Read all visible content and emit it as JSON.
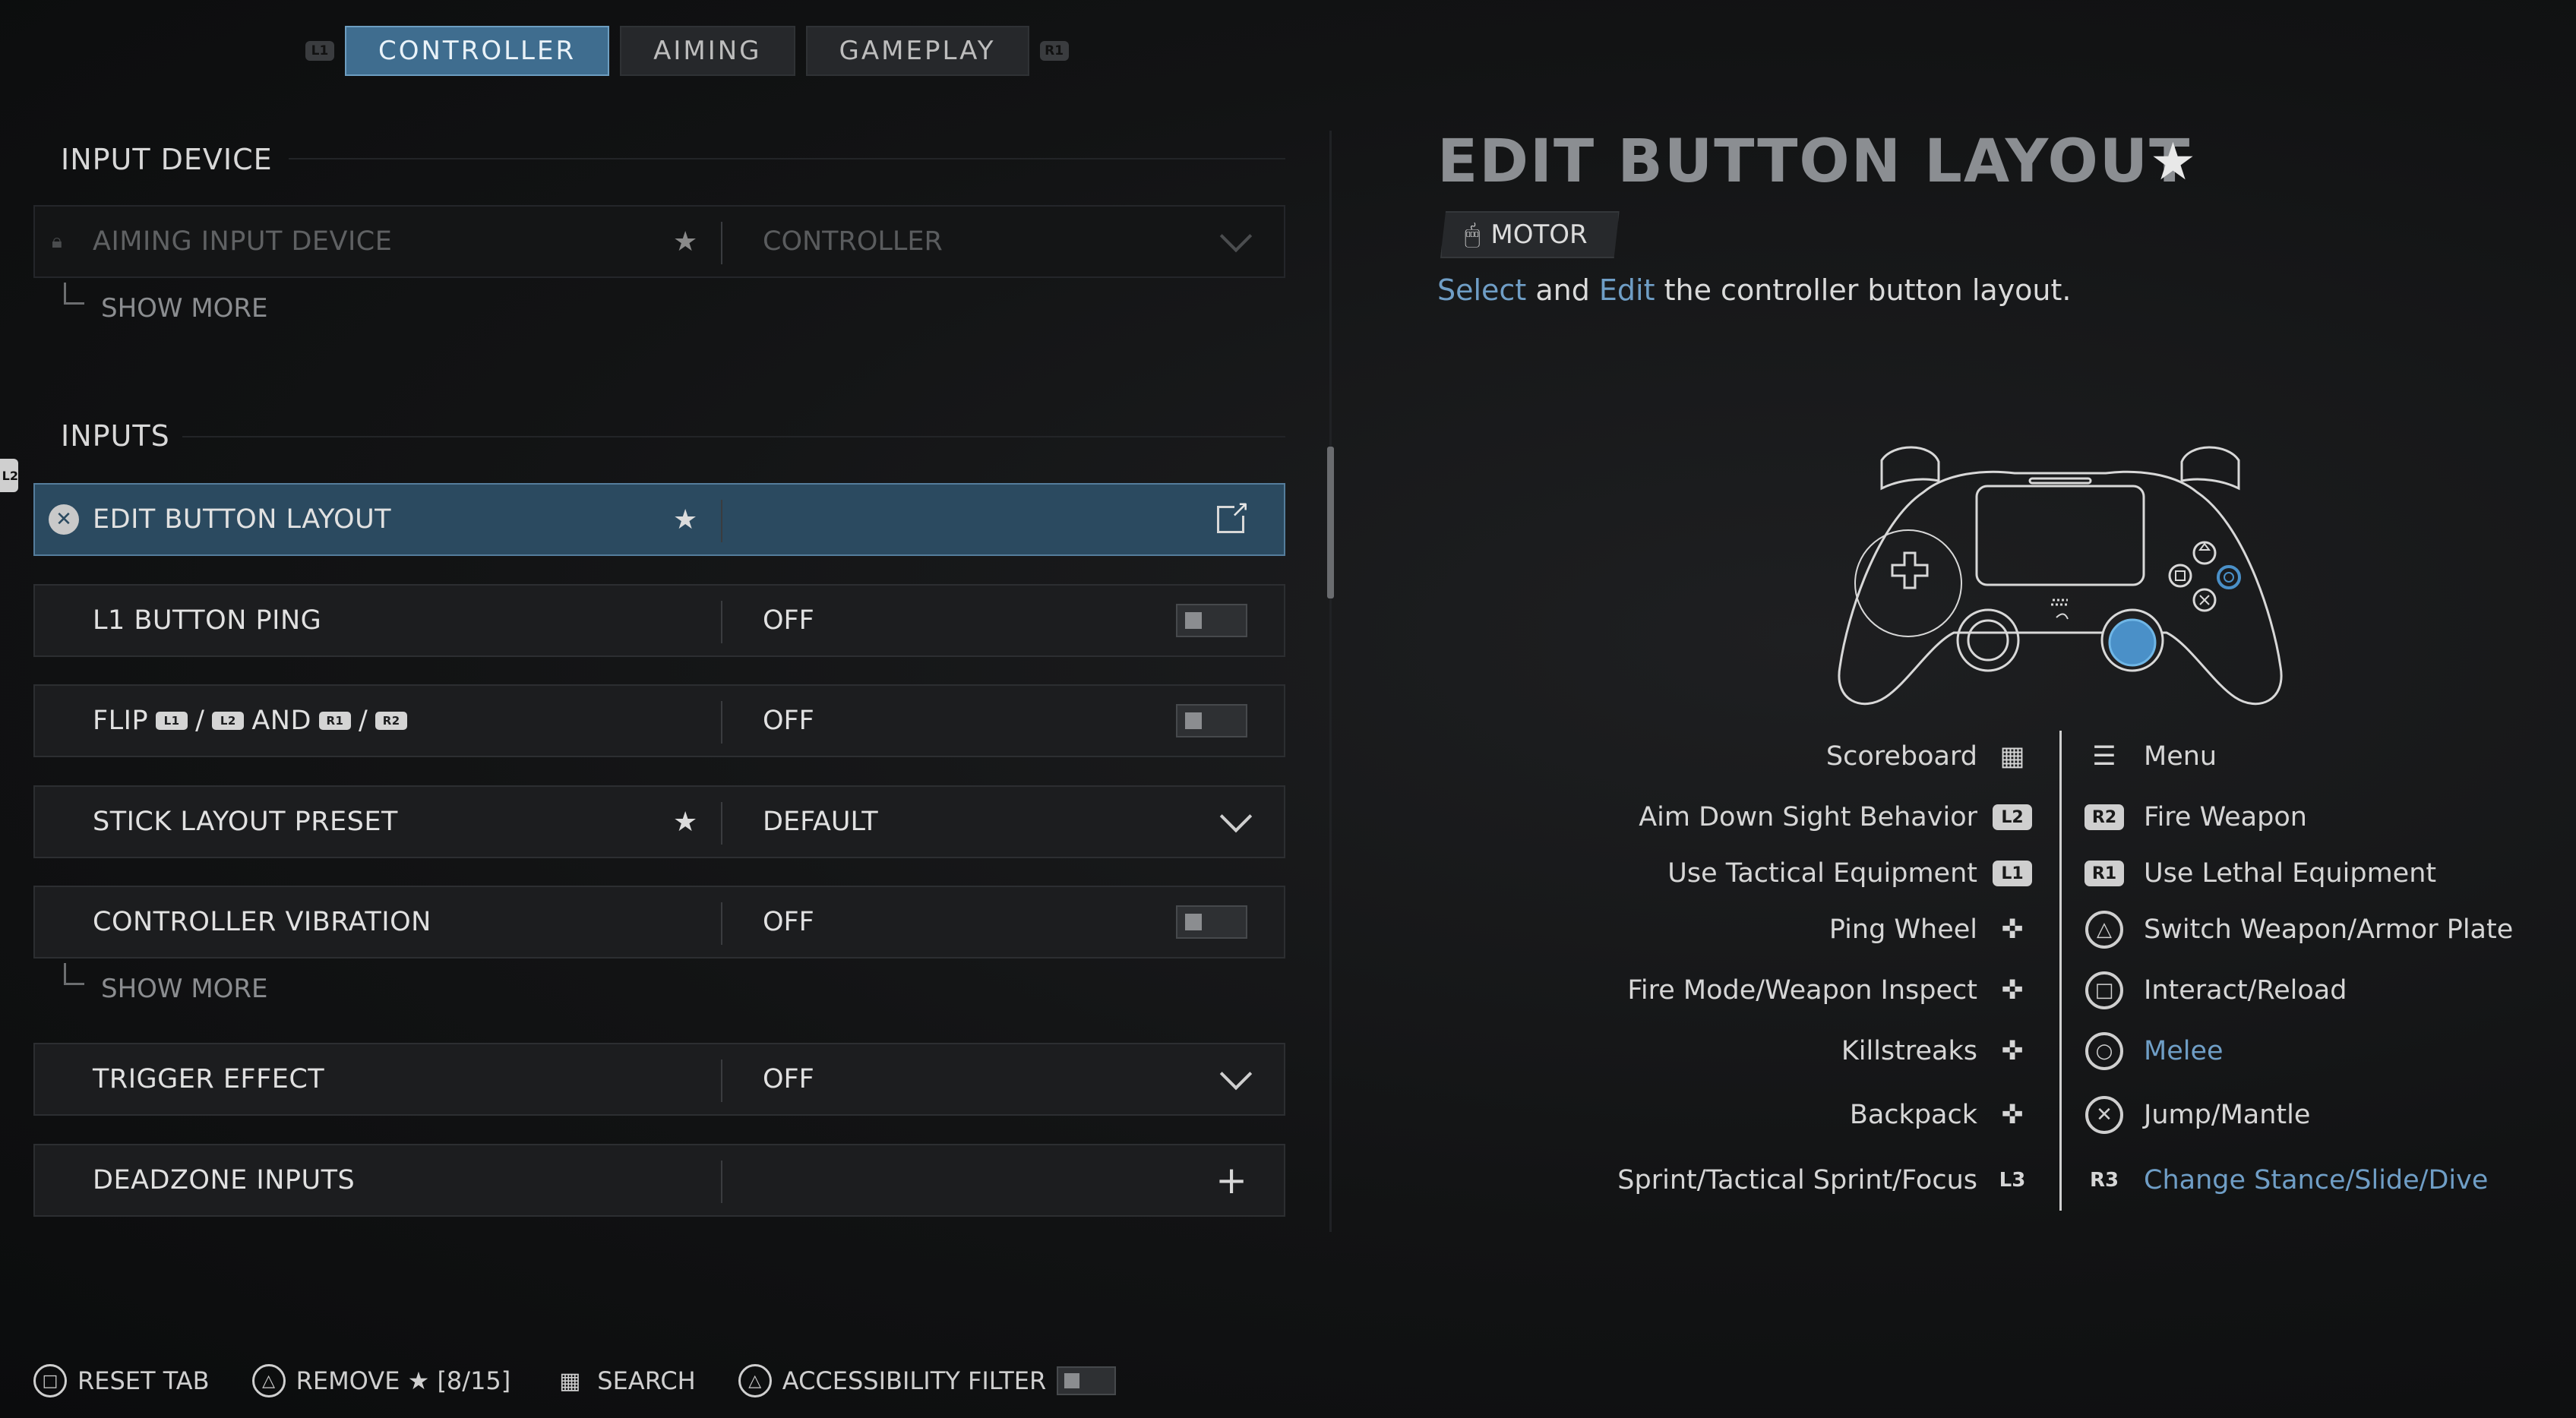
{
  "tabs": {
    "left_bumper": "L1",
    "right_bumper": "R1",
    "items": [
      {
        "label": "CONTROLLER",
        "active": true
      },
      {
        "label": "AIMING",
        "active": false
      },
      {
        "label": "GAMEPLAY",
        "active": false
      }
    ]
  },
  "edge_hint": "L2",
  "sections": {
    "input_device": {
      "title": "INPUT DEVICE",
      "rows": [
        {
          "label": "AIMING INPUT DEVICE",
          "value": "CONTROLLER",
          "locked": true,
          "favorite": true
        }
      ],
      "show_more": "SHOW MORE"
    },
    "inputs": {
      "title": "INPUTS",
      "rows": [
        {
          "label": "EDIT BUTTON LAYOUT",
          "value": "",
          "favorite": true
        },
        {
          "label": "L1 BUTTON PING",
          "value": "OFF"
        },
        {
          "label_parts": [
            "FLIP",
            "L1",
            "/",
            "L2",
            "AND",
            "R1",
            "/",
            "R2"
          ],
          "value": "OFF"
        },
        {
          "label": "STICK LAYOUT PRESET",
          "value": "DEFAULT",
          "favorite": true
        },
        {
          "label": "CONTROLLER VIBRATION",
          "value": "OFF"
        },
        {
          "label": "TRIGGER EFFECT",
          "value": "OFF"
        },
        {
          "label": "DEADZONE INPUTS",
          "value": ""
        }
      ],
      "show_more": "SHOW MORE"
    }
  },
  "detail": {
    "title": "EDIT BUTTON LAYOUT",
    "badge": "MOTOR",
    "description": {
      "w1": "Select",
      "w2": "and",
      "w3": "Edit",
      "w4": "the controller button layout."
    },
    "mappings_left": [
      {
        "action": "Scoreboard",
        "button": "touchpad-icon"
      },
      {
        "action": "Aim Down Sight Behavior",
        "button": "L2"
      },
      {
        "action": "Use Tactical Equipment",
        "button": "L1"
      },
      {
        "action": "Ping Wheel",
        "button": "dpad-up-icon"
      },
      {
        "action": "Fire Mode/Weapon Inspect",
        "button": "dpad-down-icon"
      },
      {
        "action": "Killstreaks",
        "button": "dpad-right-icon"
      },
      {
        "action": "Backpack",
        "button": "dpad-left-icon"
      },
      {
        "action": "Sprint/Tactical Sprint/Focus",
        "button": "L3"
      }
    ],
    "mappings_right": [
      {
        "action": "Menu",
        "button": "options-icon"
      },
      {
        "action": "Fire Weapon",
        "button": "R2"
      },
      {
        "action": "Use Lethal Equipment",
        "button": "R1"
      },
      {
        "action": "Switch Weapon/Armor Plate",
        "button": "triangle-icon"
      },
      {
        "action": "Interact/Reload",
        "button": "square-icon"
      },
      {
        "action": "Melee",
        "button": "circle-icon",
        "highlighted": true
      },
      {
        "action": "Jump/Mantle",
        "button": "cross-icon"
      },
      {
        "action": "Change Stance/Slide/Dive",
        "button": "R3",
        "highlighted": true
      }
    ]
  },
  "footer": {
    "reset": "RESET TAB",
    "remove": "REMOVE ★ [8/15]",
    "search": "SEARCH",
    "accessibility": "ACCESSIBILITY FILTER"
  },
  "colors": {
    "accent": "#3f6d8f",
    "highlight_text": "#6f9ec6",
    "row_bg": "#1c1d1f",
    "selected_row": "#2b4a60"
  }
}
